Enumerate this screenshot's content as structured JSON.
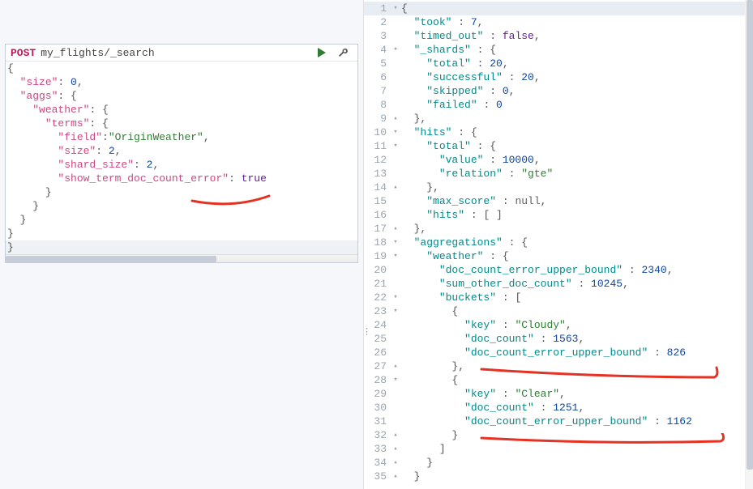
{
  "request": {
    "method": "POST",
    "path": "my_flights/_search",
    "body_lines": [
      {
        "indent": 0,
        "text": "{",
        "type": "punc"
      },
      {
        "indent": 1,
        "key": "size",
        "value": "0",
        "vtype": "num",
        "comma": true
      },
      {
        "indent": 1,
        "key": "aggs",
        "value": "{",
        "vtype": "punc"
      },
      {
        "indent": 2,
        "key": "weather",
        "value": "{",
        "vtype": "punc"
      },
      {
        "indent": 3,
        "key": "terms",
        "value": "{",
        "vtype": "punc"
      },
      {
        "indent": 4,
        "key": "field",
        "value": "OriginWeather",
        "vtype": "str",
        "comma": true
      },
      {
        "indent": 4,
        "key": "size",
        "value": "2",
        "vtype": "num",
        "comma": true
      },
      {
        "indent": 4,
        "key": "shard_size",
        "value": "2",
        "vtype": "num",
        "comma": true
      },
      {
        "indent": 4,
        "key": "show_term_doc_count_error",
        "value": "true",
        "vtype": "bool"
      },
      {
        "indent": 3,
        "text": "}",
        "type": "punc"
      },
      {
        "indent": 2,
        "text": "}",
        "type": "punc"
      },
      {
        "indent": 1,
        "text": "}",
        "type": "punc"
      },
      {
        "indent": 0,
        "text": "}",
        "type": "punc"
      },
      {
        "indent": 0,
        "text": "}|",
        "type": "cursor"
      }
    ]
  },
  "response": {
    "lines": [
      {
        "n": 1,
        "fold": "▾",
        "active": true,
        "indent": 0,
        "raw": "{"
      },
      {
        "n": 2,
        "indent": 1,
        "key": "took",
        "vtype": "num",
        "value": "7",
        "comma": true
      },
      {
        "n": 3,
        "indent": 1,
        "key": "timed_out",
        "vtype": "bool",
        "value": "false",
        "comma": true
      },
      {
        "n": 4,
        "fold": "▾",
        "indent": 1,
        "key": "_shards",
        "vtype": "open",
        "value": "{"
      },
      {
        "n": 5,
        "indent": 2,
        "key": "total",
        "vtype": "num",
        "value": "20",
        "comma": true
      },
      {
        "n": 6,
        "indent": 2,
        "key": "successful",
        "vtype": "num",
        "value": "20",
        "comma": true
      },
      {
        "n": 7,
        "indent": 2,
        "key": "skipped",
        "vtype": "num",
        "value": "0",
        "comma": true
      },
      {
        "n": 8,
        "indent": 2,
        "key": "failed",
        "vtype": "num",
        "value": "0"
      },
      {
        "n": 9,
        "fold": "▴",
        "indent": 1,
        "raw": "},"
      },
      {
        "n": 10,
        "fold": "▾",
        "indent": 1,
        "key": "hits",
        "vtype": "open",
        "value": "{"
      },
      {
        "n": 11,
        "fold": "▾",
        "indent": 2,
        "key": "total",
        "vtype": "open",
        "value": "{"
      },
      {
        "n": 12,
        "indent": 3,
        "key": "value",
        "vtype": "num",
        "value": "10000",
        "comma": true
      },
      {
        "n": 13,
        "indent": 3,
        "key": "relation",
        "vtype": "str",
        "value": "gte"
      },
      {
        "n": 14,
        "fold": "▴",
        "indent": 2,
        "raw": "},"
      },
      {
        "n": 15,
        "indent": 2,
        "key": "max_score",
        "vtype": "null",
        "value": "null",
        "comma": true
      },
      {
        "n": 16,
        "indent": 2,
        "key": "hits",
        "vtype": "arr",
        "value": "[ ]"
      },
      {
        "n": 17,
        "fold": "▴",
        "indent": 1,
        "raw": "},"
      },
      {
        "n": 18,
        "fold": "▾",
        "indent": 1,
        "key": "aggregations",
        "vtype": "open",
        "value": "{"
      },
      {
        "n": 19,
        "fold": "▾",
        "indent": 2,
        "key": "weather",
        "vtype": "open",
        "value": "{"
      },
      {
        "n": 20,
        "indent": 3,
        "key": "doc_count_error_upper_bound",
        "vtype": "num",
        "value": "2340",
        "comma": true
      },
      {
        "n": 21,
        "indent": 3,
        "key": "sum_other_doc_count",
        "vtype": "num",
        "value": "10245",
        "comma": true
      },
      {
        "n": 22,
        "fold": "▾",
        "indent": 3,
        "key": "buckets",
        "vtype": "open",
        "value": "["
      },
      {
        "n": 23,
        "fold": "▾",
        "indent": 4,
        "raw": "{"
      },
      {
        "n": 24,
        "indent": 5,
        "key": "key",
        "vtype": "str",
        "value": "Cloudy",
        "comma": true
      },
      {
        "n": 25,
        "indent": 5,
        "key": "doc_count",
        "vtype": "num",
        "value": "1563",
        "comma": true
      },
      {
        "n": 26,
        "indent": 5,
        "key": "doc_count_error_upper_bound",
        "vtype": "num",
        "value": "826"
      },
      {
        "n": 27,
        "fold": "▴",
        "indent": 4,
        "raw": "},"
      },
      {
        "n": 28,
        "fold": "▾",
        "indent": 4,
        "raw": "{"
      },
      {
        "n": 29,
        "indent": 5,
        "key": "key",
        "vtype": "str",
        "value": "Clear",
        "comma": true
      },
      {
        "n": 30,
        "indent": 5,
        "key": "doc_count",
        "vtype": "num",
        "value": "1251",
        "comma": true
      },
      {
        "n": 31,
        "indent": 5,
        "key": "doc_count_error_upper_bound",
        "vtype": "num",
        "value": "1162"
      },
      {
        "n": 32,
        "fold": "▴",
        "indent": 4,
        "raw": "}"
      },
      {
        "n": 33,
        "fold": "▴",
        "indent": 3,
        "raw": "]"
      },
      {
        "n": 34,
        "fold": "▴",
        "indent": 2,
        "raw": "}"
      },
      {
        "n": 35,
        "fold": "▴",
        "indent": 1,
        "raw": "}"
      }
    ]
  },
  "icons": {
    "run": "run-icon",
    "wrench": "wrench-icon"
  }
}
